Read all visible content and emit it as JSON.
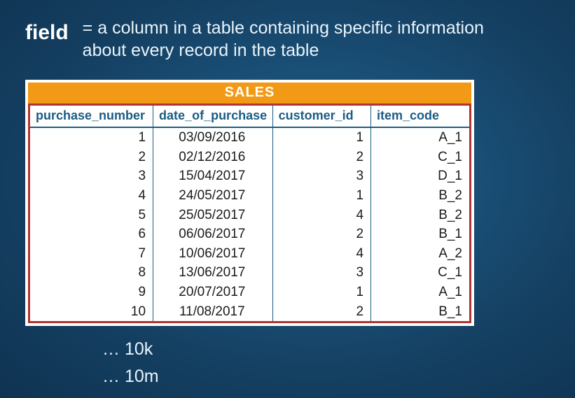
{
  "heading": {
    "term": "field",
    "definition": "= a column in a table containing specific information about every record in the table"
  },
  "table": {
    "title": "SALES",
    "columns": [
      "purchase_number",
      "date_of_purchase",
      "customer_id",
      "item_code"
    ],
    "rows": [
      {
        "purchase_number": "1",
        "date_of_purchase": "03/09/2016",
        "customer_id": "1",
        "item_code": "A_1"
      },
      {
        "purchase_number": "2",
        "date_of_purchase": "02/12/2016",
        "customer_id": "2",
        "item_code": "C_1"
      },
      {
        "purchase_number": "3",
        "date_of_purchase": "15/04/2017",
        "customer_id": "3",
        "item_code": "D_1"
      },
      {
        "purchase_number": "4",
        "date_of_purchase": "24/05/2017",
        "customer_id": "1",
        "item_code": "B_2"
      },
      {
        "purchase_number": "5",
        "date_of_purchase": "25/05/2017",
        "customer_id": "4",
        "item_code": "B_2"
      },
      {
        "purchase_number": "6",
        "date_of_purchase": "06/06/2017",
        "customer_id": "2",
        "item_code": "B_1"
      },
      {
        "purchase_number": "7",
        "date_of_purchase": "10/06/2017",
        "customer_id": "4",
        "item_code": "A_2"
      },
      {
        "purchase_number": "8",
        "date_of_purchase": "13/06/2017",
        "customer_id": "3",
        "item_code": "C_1"
      },
      {
        "purchase_number": "9",
        "date_of_purchase": "20/07/2017",
        "customer_id": "1",
        "item_code": "A_1"
      },
      {
        "purchase_number": "10",
        "date_of_purchase": "11/08/2017",
        "customer_id": "2",
        "item_code": "B_1"
      }
    ]
  },
  "notes": {
    "line1": "… 10k",
    "line2": "… 10m"
  }
}
